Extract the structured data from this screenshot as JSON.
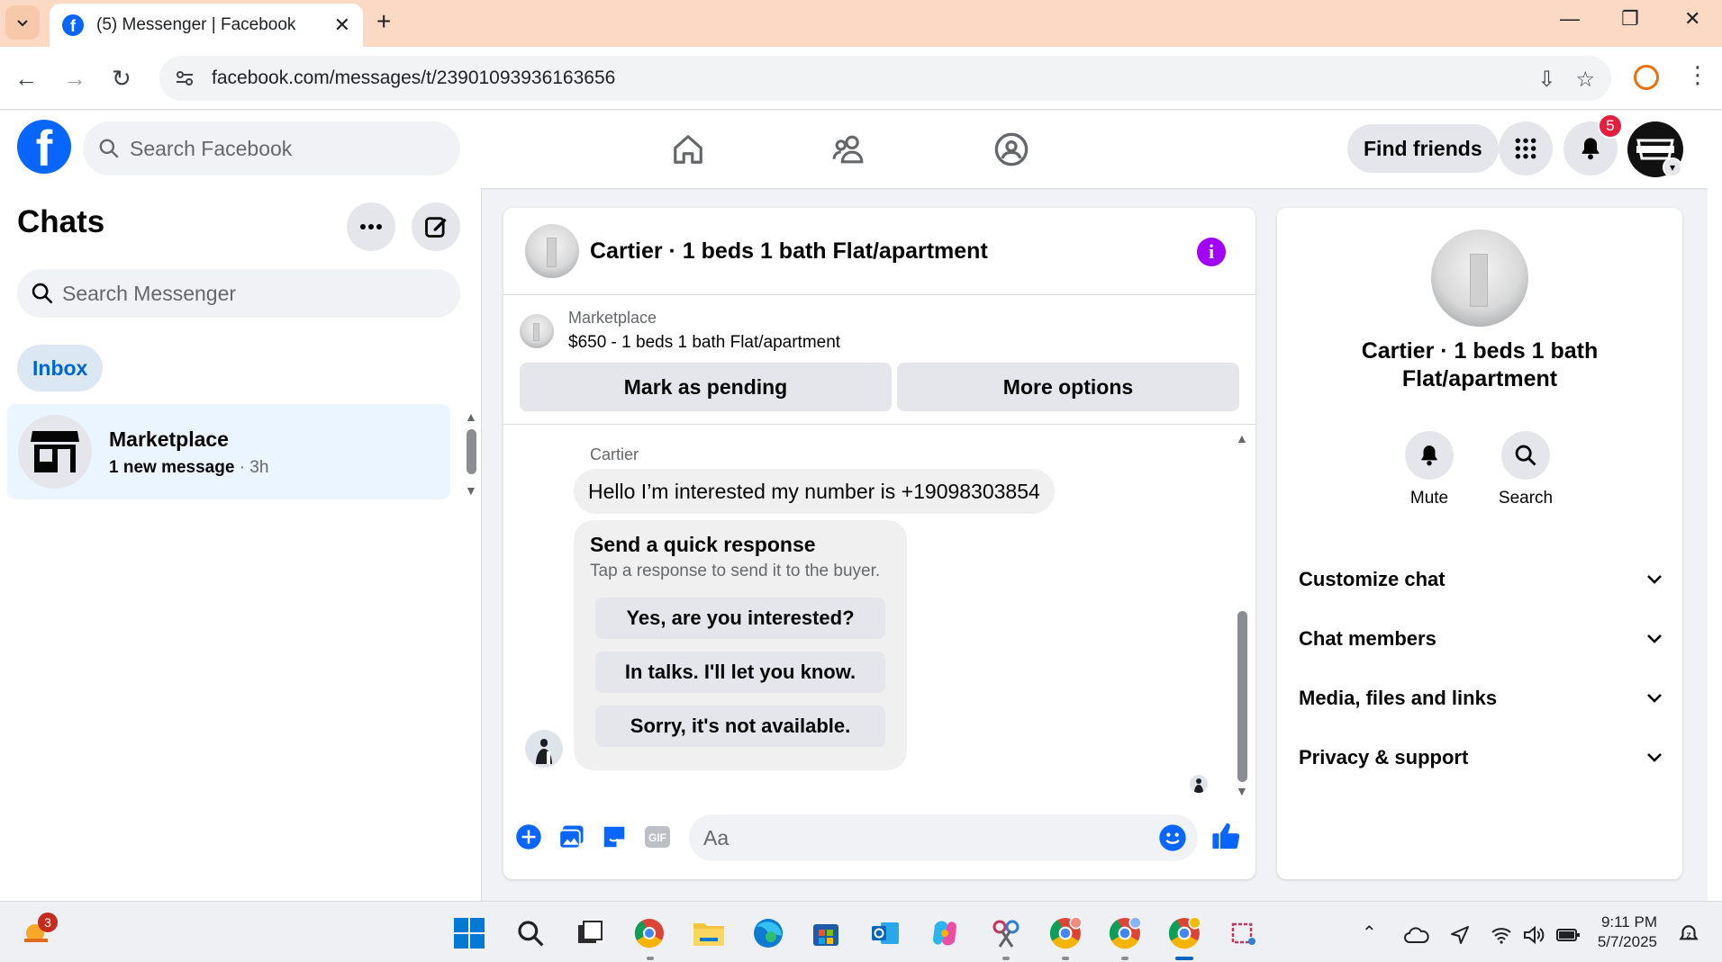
{
  "browser": {
    "tab_title": "(5) Messenger | Facebook",
    "url": "facebook.com/messages/t/23901093936163656"
  },
  "header": {
    "search_placeholder": "Search Facebook",
    "find_friends_label": "Find friends",
    "notification_count": "5",
    "nav_icons": [
      "home-icon",
      "friends-icon",
      "groups-icon"
    ]
  },
  "sidebar": {
    "title": "Chats",
    "search_placeholder": "Search Messenger",
    "filter_label": "Inbox",
    "conversations": [
      {
        "name": "Marketplace",
        "preview": "1 new message",
        "time": " · 3h"
      }
    ]
  },
  "conversation": {
    "title": "Cartier · 1 beds 1 bath Flat/apartment",
    "marketplace_label": "Marketplace",
    "listing": "$650 - 1 beds 1 bath Flat/apartment",
    "mark_pending_label": "Mark as pending",
    "more_options_label": "More options",
    "sender_name": "Cartier",
    "message": "Hello I’m interested my number is +19098303854",
    "quick_response": {
      "title": "Send a quick response",
      "subtitle": "Tap a response to send it to the buyer.",
      "options": [
        "Yes, are you interested?",
        "In talks. I'll let you know.",
        "Sorry, it's not available."
      ]
    },
    "composer_placeholder": "Aa"
  },
  "info_panel": {
    "title": "Cartier · 1 beds 1 bath Flat/apartment",
    "mute_label": "Mute",
    "search_label": "Search",
    "sections": [
      "Customize chat",
      "Chat members",
      "Media, files and links",
      "Privacy & support"
    ]
  },
  "taskbar": {
    "weather_badge": "3",
    "time": "9:11 PM",
    "date": "5/7/2025"
  },
  "colors": {
    "facebook_blue": "#0866ff",
    "inbox_pill_bg": "#dbe7f2",
    "info_purple": "#a100ff",
    "badge_red": "#e41e3f"
  }
}
